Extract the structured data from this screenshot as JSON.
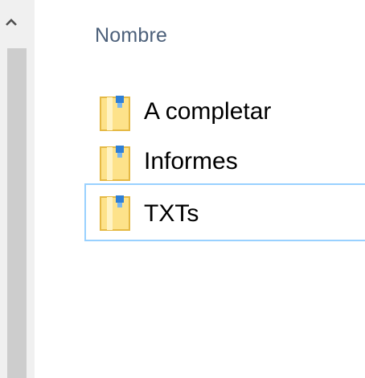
{
  "scrollbar": {
    "up_icon": "chevron-up-icon"
  },
  "header": {
    "column_name": "Nombre"
  },
  "files": [
    {
      "name": "A completar",
      "icon": "folder-icon",
      "selected": false
    },
    {
      "name": "Informes",
      "icon": "folder-icon",
      "selected": false
    },
    {
      "name": "TXTs",
      "icon": "folder-icon",
      "selected": true
    }
  ],
  "colors": {
    "header_text": "#4c607a",
    "selection_border": "#99d1ff",
    "folder_body": "#fde28a",
    "folder_edge": "#e5b944",
    "folder_badge": "#2f7fd6"
  }
}
